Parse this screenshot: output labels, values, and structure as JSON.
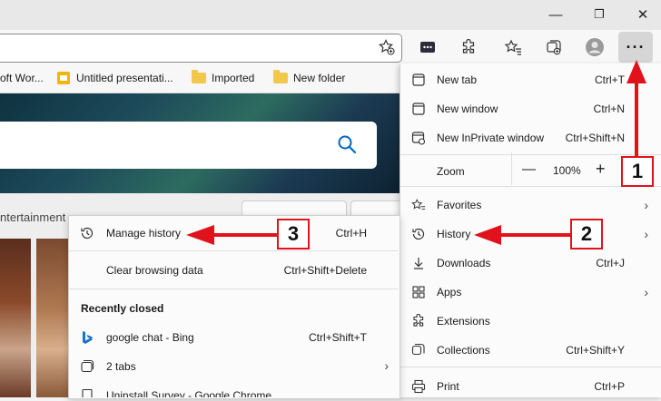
{
  "window": {
    "minimize": "—",
    "maximize": "❐",
    "close": "✕"
  },
  "favorites_bar": [
    {
      "label": "oft Wor...",
      "icon": "word-icon"
    },
    {
      "label": "Untitled presentati...",
      "icon": "slides-icon"
    },
    {
      "label": "Imported",
      "icon": "folder-icon"
    },
    {
      "label": "New folder",
      "icon": "folder-icon"
    }
  ],
  "page": {
    "news_label": "ntertainment",
    "button1": "",
    "button2": ""
  },
  "menu": {
    "new_tab": {
      "label": "New tab",
      "shortcut": "Ctrl+T"
    },
    "new_window": {
      "label": "New window",
      "shortcut": "Ctrl+N"
    },
    "new_inprivate": {
      "label": "New InPrivate window",
      "shortcut": "Ctrl+Shift+N"
    },
    "zoom": {
      "label": "Zoom",
      "minus": "—",
      "value": "100%",
      "plus": "+"
    },
    "favorites": {
      "label": "Favorites"
    },
    "history": {
      "label": "History"
    },
    "downloads": {
      "label": "Downloads",
      "shortcut": "Ctrl+J"
    },
    "apps": {
      "label": "Apps"
    },
    "extensions": {
      "label": "Extensions"
    },
    "collections": {
      "label": "Collections",
      "shortcut": "Ctrl+Shift+Y"
    },
    "print": {
      "label": "Print",
      "shortcut": "Ctrl+P"
    }
  },
  "history_menu": {
    "manage": {
      "label": "Manage history",
      "shortcut": "Ctrl+H"
    },
    "clear": {
      "label": "Clear browsing data",
      "shortcut": "Ctrl+Shift+Delete"
    },
    "recently_closed_heading": "Recently closed",
    "items": [
      {
        "label": "google chat - Bing",
        "shortcut": "Ctrl+Shift+T",
        "icon": "bing-icon"
      },
      {
        "label": "2 tabs",
        "icon": "tabs-icon"
      },
      {
        "label": "Uninstall Survey - Google Chrome",
        "icon": "page-icon"
      }
    ]
  },
  "annotations": {
    "step1": "1",
    "step2": "2",
    "step3": "3",
    "color": "#e0131c"
  },
  "colors": {
    "accent": "#0067c0",
    "annotation_red": "#e0131c"
  }
}
